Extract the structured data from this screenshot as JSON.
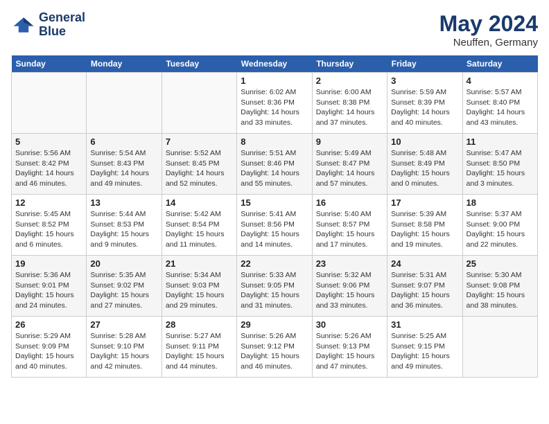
{
  "header": {
    "logo_line1": "General",
    "logo_line2": "Blue",
    "month": "May 2024",
    "location": "Neuffen, Germany"
  },
  "weekdays": [
    "Sunday",
    "Monday",
    "Tuesday",
    "Wednesday",
    "Thursday",
    "Friday",
    "Saturday"
  ],
  "weeks": [
    [
      {
        "day": "",
        "text": ""
      },
      {
        "day": "",
        "text": ""
      },
      {
        "day": "",
        "text": ""
      },
      {
        "day": "1",
        "text": "Sunrise: 6:02 AM\nSunset: 8:36 PM\nDaylight: 14 hours\nand 33 minutes."
      },
      {
        "day": "2",
        "text": "Sunrise: 6:00 AM\nSunset: 8:38 PM\nDaylight: 14 hours\nand 37 minutes."
      },
      {
        "day": "3",
        "text": "Sunrise: 5:59 AM\nSunset: 8:39 PM\nDaylight: 14 hours\nand 40 minutes."
      },
      {
        "day": "4",
        "text": "Sunrise: 5:57 AM\nSunset: 8:40 PM\nDaylight: 14 hours\nand 43 minutes."
      }
    ],
    [
      {
        "day": "5",
        "text": "Sunrise: 5:56 AM\nSunset: 8:42 PM\nDaylight: 14 hours\nand 46 minutes."
      },
      {
        "day": "6",
        "text": "Sunrise: 5:54 AM\nSunset: 8:43 PM\nDaylight: 14 hours\nand 49 minutes."
      },
      {
        "day": "7",
        "text": "Sunrise: 5:52 AM\nSunset: 8:45 PM\nDaylight: 14 hours\nand 52 minutes."
      },
      {
        "day": "8",
        "text": "Sunrise: 5:51 AM\nSunset: 8:46 PM\nDaylight: 14 hours\nand 55 minutes."
      },
      {
        "day": "9",
        "text": "Sunrise: 5:49 AM\nSunset: 8:47 PM\nDaylight: 14 hours\nand 57 minutes."
      },
      {
        "day": "10",
        "text": "Sunrise: 5:48 AM\nSunset: 8:49 PM\nDaylight: 15 hours\nand 0 minutes."
      },
      {
        "day": "11",
        "text": "Sunrise: 5:47 AM\nSunset: 8:50 PM\nDaylight: 15 hours\nand 3 minutes."
      }
    ],
    [
      {
        "day": "12",
        "text": "Sunrise: 5:45 AM\nSunset: 8:52 PM\nDaylight: 15 hours\nand 6 minutes."
      },
      {
        "day": "13",
        "text": "Sunrise: 5:44 AM\nSunset: 8:53 PM\nDaylight: 15 hours\nand 9 minutes."
      },
      {
        "day": "14",
        "text": "Sunrise: 5:42 AM\nSunset: 8:54 PM\nDaylight: 15 hours\nand 11 minutes."
      },
      {
        "day": "15",
        "text": "Sunrise: 5:41 AM\nSunset: 8:56 PM\nDaylight: 15 hours\nand 14 minutes."
      },
      {
        "day": "16",
        "text": "Sunrise: 5:40 AM\nSunset: 8:57 PM\nDaylight: 15 hours\nand 17 minutes."
      },
      {
        "day": "17",
        "text": "Sunrise: 5:39 AM\nSunset: 8:58 PM\nDaylight: 15 hours\nand 19 minutes."
      },
      {
        "day": "18",
        "text": "Sunrise: 5:37 AM\nSunset: 9:00 PM\nDaylight: 15 hours\nand 22 minutes."
      }
    ],
    [
      {
        "day": "19",
        "text": "Sunrise: 5:36 AM\nSunset: 9:01 PM\nDaylight: 15 hours\nand 24 minutes."
      },
      {
        "day": "20",
        "text": "Sunrise: 5:35 AM\nSunset: 9:02 PM\nDaylight: 15 hours\nand 27 minutes."
      },
      {
        "day": "21",
        "text": "Sunrise: 5:34 AM\nSunset: 9:03 PM\nDaylight: 15 hours\nand 29 minutes."
      },
      {
        "day": "22",
        "text": "Sunrise: 5:33 AM\nSunset: 9:05 PM\nDaylight: 15 hours\nand 31 minutes."
      },
      {
        "day": "23",
        "text": "Sunrise: 5:32 AM\nSunset: 9:06 PM\nDaylight: 15 hours\nand 33 minutes."
      },
      {
        "day": "24",
        "text": "Sunrise: 5:31 AM\nSunset: 9:07 PM\nDaylight: 15 hours\nand 36 minutes."
      },
      {
        "day": "25",
        "text": "Sunrise: 5:30 AM\nSunset: 9:08 PM\nDaylight: 15 hours\nand 38 minutes."
      }
    ],
    [
      {
        "day": "26",
        "text": "Sunrise: 5:29 AM\nSunset: 9:09 PM\nDaylight: 15 hours\nand 40 minutes."
      },
      {
        "day": "27",
        "text": "Sunrise: 5:28 AM\nSunset: 9:10 PM\nDaylight: 15 hours\nand 42 minutes."
      },
      {
        "day": "28",
        "text": "Sunrise: 5:27 AM\nSunset: 9:11 PM\nDaylight: 15 hours\nand 44 minutes."
      },
      {
        "day": "29",
        "text": "Sunrise: 5:26 AM\nSunset: 9:12 PM\nDaylight: 15 hours\nand 46 minutes."
      },
      {
        "day": "30",
        "text": "Sunrise: 5:26 AM\nSunset: 9:13 PM\nDaylight: 15 hours\nand 47 minutes."
      },
      {
        "day": "31",
        "text": "Sunrise: 5:25 AM\nSunset: 9:15 PM\nDaylight: 15 hours\nand 49 minutes."
      },
      {
        "day": "",
        "text": ""
      }
    ]
  ]
}
